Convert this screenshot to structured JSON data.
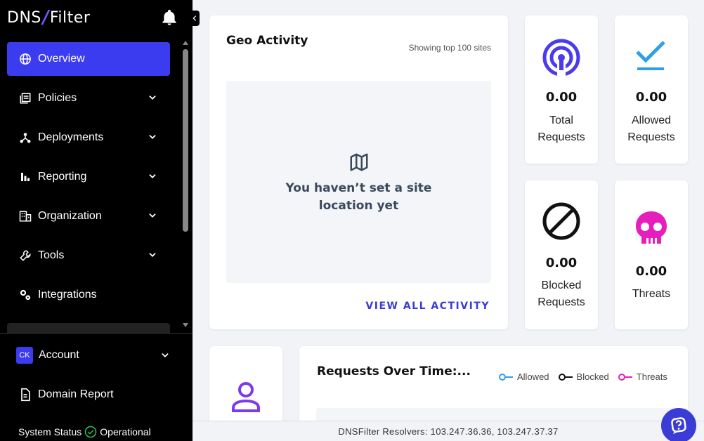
{
  "brand": {
    "logo_left": "DNS",
    "logo_right": "Filter",
    "accent": "#3b3bf0"
  },
  "sidebar": {
    "items": [
      {
        "label": "Overview",
        "icon": "globe-icon",
        "active": true,
        "has_chevron": false
      },
      {
        "label": "Policies",
        "icon": "policies-icon",
        "has_chevron": true
      },
      {
        "label": "Deployments",
        "icon": "deployments-icon",
        "has_chevron": true
      },
      {
        "label": "Reporting",
        "icon": "bar-chart-icon",
        "has_chevron": true
      },
      {
        "label": "Organization",
        "icon": "building-icon",
        "has_chevron": true
      },
      {
        "label": "Tools",
        "icon": "wrench-icon",
        "has_chevron": true
      },
      {
        "label": "Integrations",
        "icon": "gears-icon",
        "has_chevron": false
      }
    ],
    "account": {
      "initials": "CK",
      "label": "Account"
    },
    "domain_report": {
      "label": "Domain Report"
    },
    "status": {
      "label": "System Status",
      "value": "Operational",
      "color": "#22c55e"
    }
  },
  "geo": {
    "title": "Geo Activity",
    "subtitle": "Showing top 100 sites",
    "empty_message": "You haven’t set a site location yet",
    "link": "VIEW ALL ACTIVITY"
  },
  "stats": {
    "total": {
      "value": "0.00",
      "label": "Total Requests",
      "color": "#4b3bea"
    },
    "allowed": {
      "value": "0.00",
      "label": "Allowed Requests",
      "color": "#2f9fe6"
    },
    "blocked": {
      "value": "0.00",
      "label": "Blocked Requests",
      "color": "#111111"
    },
    "threats": {
      "value": "0.00",
      "label": "Threats",
      "color": "#e61fbc"
    }
  },
  "requests_over_time": {
    "title": "Requests Over Time:...",
    "legend": [
      {
        "label": "Allowed",
        "color": "#2f9fe6"
      },
      {
        "label": "Blocked",
        "color": "#111111"
      },
      {
        "label": "Threats",
        "color": "#e61fbc"
      }
    ]
  },
  "footer": {
    "resolvers": "DNSFilter Resolvers: 103.247.36.36, 103.247.37.37"
  }
}
